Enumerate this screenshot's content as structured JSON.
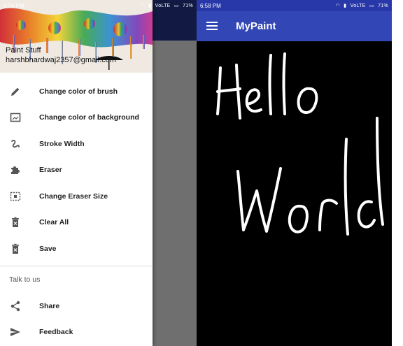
{
  "left_screen": {
    "status": {
      "time": "6:56 PM",
      "network": "VoLTE",
      "battery": "71%"
    },
    "drawer": {
      "header": {
        "name": "Paint Stuff",
        "email": "harshbhardwaj2357@gmail.com"
      },
      "items": [
        {
          "label": "Change color of brush",
          "icon": "pencil-icon"
        },
        {
          "label": "Change color of background",
          "icon": "picture-frame-icon"
        },
        {
          "label": "Stroke Width",
          "icon": "stroke-icon"
        },
        {
          "label": "Eraser",
          "icon": "puzzle-icon"
        },
        {
          "label": "Change Eraser Size",
          "icon": "resize-icon"
        },
        {
          "label": "Clear All",
          "icon": "trash-icon"
        },
        {
          "label": "Save",
          "icon": "trash-icon"
        }
      ],
      "section_title": "Talk to us",
      "section_items": [
        {
          "label": "Share",
          "icon": "share-icon"
        },
        {
          "label": "Feedback",
          "icon": "send-icon"
        }
      ]
    }
  },
  "right_screen": {
    "status": {
      "time": "6:58 PM",
      "network": "VoLTE",
      "battery": "71%"
    },
    "app_bar": {
      "title": "MyPaint"
    },
    "canvas_text": [
      "Hello",
      "World"
    ]
  },
  "colors": {
    "app_bar": "#3346b5",
    "status_bar": "#2838a8",
    "canvas": "#000000",
    "drawing": "#ffffff"
  }
}
